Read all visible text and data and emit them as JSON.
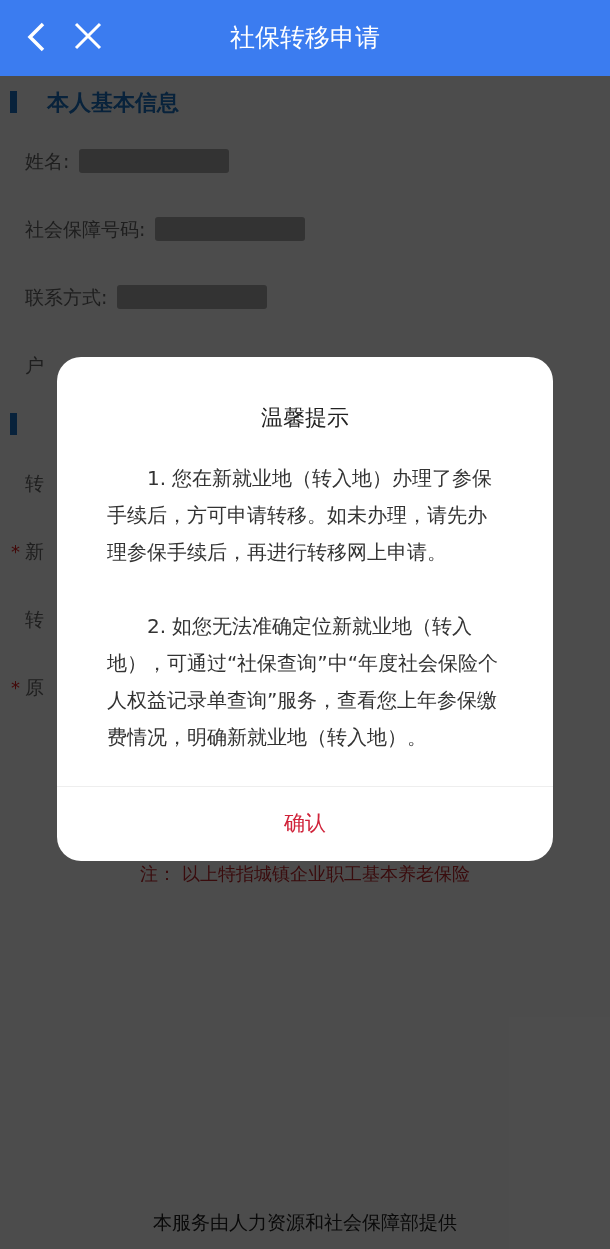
{
  "header": {
    "title": "社保转移申请"
  },
  "sections": [
    {
      "title": "本人基本信息",
      "rows": [
        {
          "label": "姓名:",
          "redacted": true
        },
        {
          "label": "社会保障号码:",
          "redacted": true
        },
        {
          "label": "联系方式:",
          "redacted": true
        },
        {
          "label": "户"
        }
      ]
    },
    {
      "rows": [
        {
          "label": "转"
        },
        {
          "label": "新",
          "required_mark": "*"
        },
        {
          "label": "转"
        },
        {
          "label": "原",
          "required_mark": "*"
        }
      ]
    }
  ],
  "note": "注： 以上特指城镇企业职工基本养老保险",
  "footer": "本服务由人力资源和社会保障部提供",
  "dialog": {
    "title": "温馨提示",
    "paragraphs": [
      "1. 您在新就业地（转入地）办理了参保手续后，方可申请转移。如未办理，请先办理参保手续后，再进行转移网上申请。",
      "2. 如您无法准确定位新就业地（转入地），可通过“社保查询”中“年度社会保险个人权益记录单查询”服务，查看您上年参保缴费情况，明确新就业地（转入地）。"
    ],
    "confirm": "确认"
  }
}
